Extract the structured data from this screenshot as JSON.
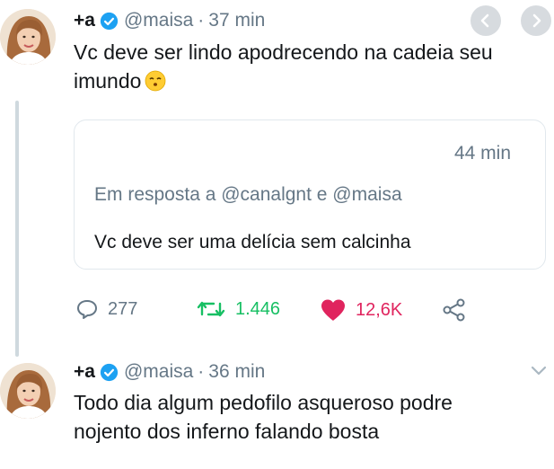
{
  "tweet1": {
    "display_name": "+a",
    "handle": "@maisa",
    "time": "37 min",
    "text": "Vc deve ser lindo apodrecendo na cadeia seu imundo",
    "emoji": "kissing-face-emoji"
  },
  "quoted": {
    "time": "44 min",
    "reply_to": "Em resposta a @canalgnt e @maisa",
    "text": "Vc deve ser uma delícia sem calcinha"
  },
  "actions": {
    "replies": "277",
    "retweets": "1.446",
    "likes": "12,6K"
  },
  "tweet2": {
    "display_name": "+a",
    "handle": "@maisa",
    "time": "36 min",
    "text": "Todo dia algum pedofilo asqueroso podre nojento dos inferno falando bosta"
  },
  "colors": {
    "verified": "#1da1f2",
    "retweet": "#17bf63",
    "like": "#e0245e",
    "muted": "#657786"
  },
  "icons": [
    "chevron-left-icon",
    "chevron-right-icon",
    "verified-badge-icon",
    "reply-icon",
    "retweet-icon",
    "heart-icon",
    "share-icon",
    "chevron-down-icon"
  ],
  "dot": "·"
}
